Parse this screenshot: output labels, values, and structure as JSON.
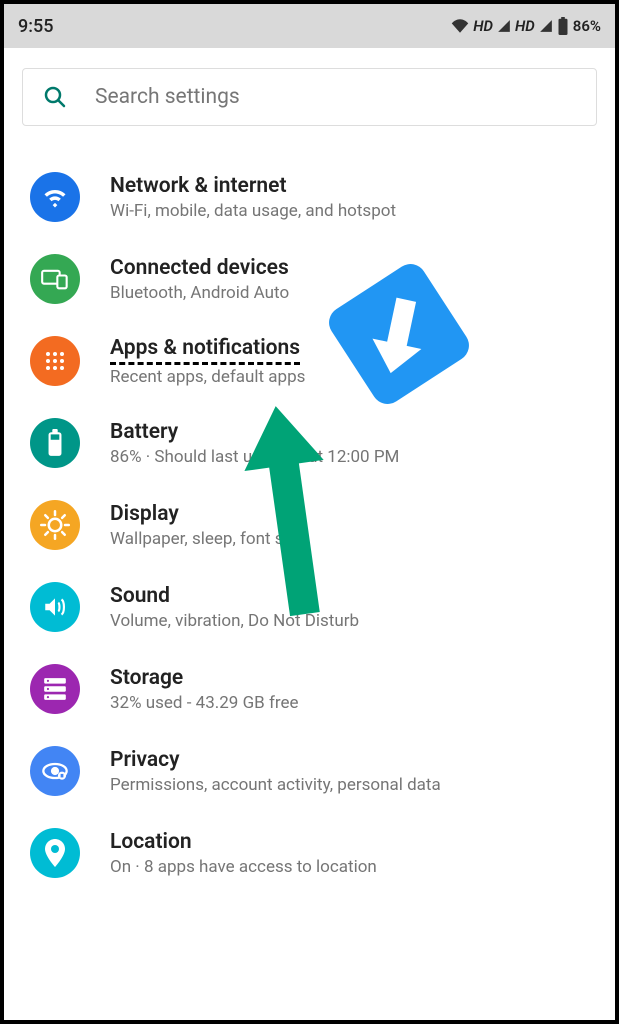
{
  "status_bar": {
    "time": "9:55",
    "hd1": "HD",
    "hd2": "HD",
    "battery": "86%"
  },
  "search": {
    "placeholder": "Search settings"
  },
  "settings": [
    {
      "key": "network",
      "title": "Network & internet",
      "sub": "Wi-Fi, mobile, data usage, and hotspot"
    },
    {
      "key": "connected",
      "title": "Connected devices",
      "sub": "Bluetooth, Android Auto"
    },
    {
      "key": "apps",
      "title": "Apps & notifications",
      "sub": "Recent apps, default apps"
    },
    {
      "key": "battery",
      "title": "Battery",
      "sub": "86% · Should last until about 12:00 PM"
    },
    {
      "key": "display",
      "title": "Display",
      "sub": "Wallpaper, sleep, font size"
    },
    {
      "key": "sound",
      "title": "Sound",
      "sub": "Volume, vibration, Do Not Disturb"
    },
    {
      "key": "storage",
      "title": "Storage",
      "sub": "32% used - 43.29 GB free"
    },
    {
      "key": "privacy",
      "title": "Privacy",
      "sub": "Permissions, account activity, personal data"
    },
    {
      "key": "location",
      "title": "Location",
      "sub": "On · 8 apps have access to location"
    }
  ]
}
